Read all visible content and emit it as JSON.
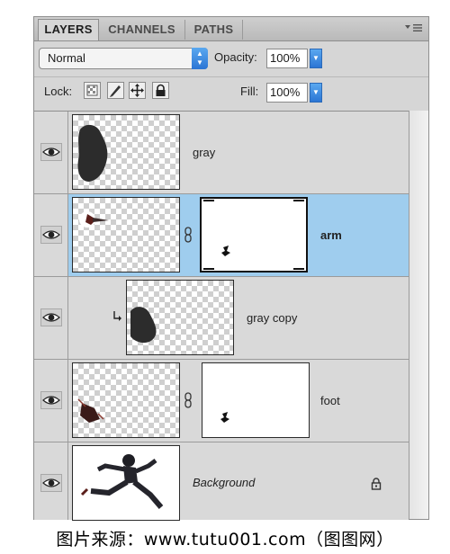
{
  "tabs": [
    {
      "label": "LAYERS",
      "active": true
    },
    {
      "label": "CHANNELS",
      "active": false
    },
    {
      "label": "PATHS",
      "active": false
    }
  ],
  "panel_menu_icon": "panel-menu-icon",
  "blend_mode": {
    "value": "Normal"
  },
  "opacity": {
    "label": "Opacity:",
    "value": "100%"
  },
  "lock": {
    "label": "Lock:",
    "icons": [
      "lock-transparent-icon",
      "lock-image-icon",
      "lock-position-icon",
      "lock-all-icon"
    ]
  },
  "fill": {
    "label": "Fill:",
    "value": "100%"
  },
  "layers": [
    {
      "name": "gray",
      "selected": false,
      "has_mask": false,
      "clipped": false,
      "locked": false
    },
    {
      "name": "arm",
      "selected": true,
      "has_mask": true,
      "clipped": false,
      "locked": false
    },
    {
      "name": "gray copy",
      "selected": false,
      "has_mask": false,
      "clipped": true,
      "locked": false
    },
    {
      "name": "foot",
      "selected": false,
      "has_mask": true,
      "clipped": false,
      "locked": false
    },
    {
      "name": "Background",
      "selected": false,
      "has_mask": false,
      "clipped": false,
      "locked": true
    }
  ],
  "colors": {
    "selection": "#9fcdee",
    "accent": "#2b75d4"
  },
  "caption": "图片来源：www.tutu001.com（图图网）"
}
